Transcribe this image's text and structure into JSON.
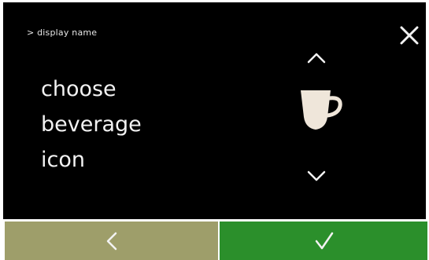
{
  "header": {
    "breadcrumb": "> display name",
    "close_icon": "close-icon"
  },
  "main": {
    "title_lines": [
      "choose",
      "beverage",
      "icon"
    ],
    "selector": {
      "up_icon": "chevron-up-icon",
      "current_icon": "coffee-cup-icon",
      "down_icon": "chevron-down-icon"
    }
  },
  "footer": {
    "back_icon": "chevron-left-icon",
    "confirm_icon": "checkmark-icon"
  },
  "colors": {
    "background": "#000000",
    "back_button": "#9e9e6a",
    "confirm_button": "#2b8f2b",
    "text": "#f2f2f2"
  }
}
